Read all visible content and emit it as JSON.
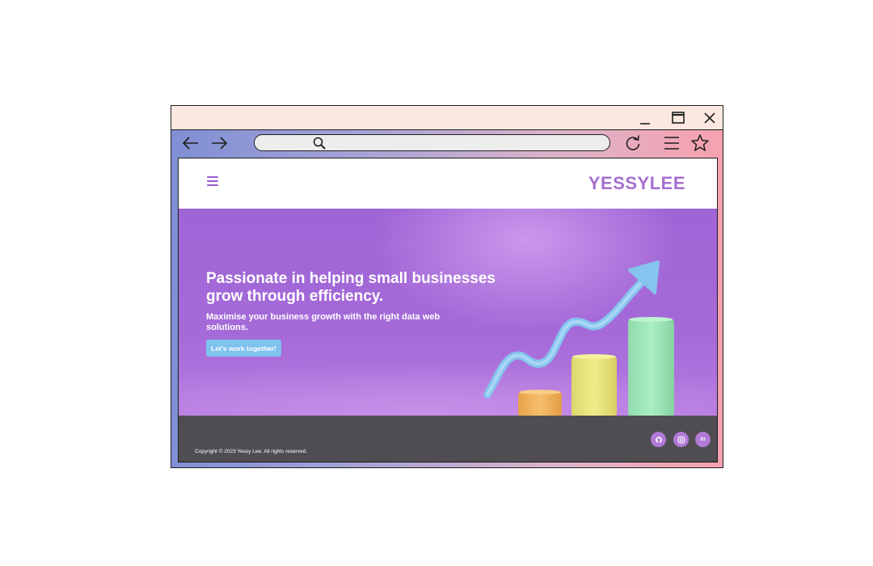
{
  "browser": {
    "window_controls": {
      "minimize_icon": "minimize-icon",
      "maximize_icon": "maximize-icon",
      "close_icon": "close-icon"
    },
    "toolbar": {
      "back_icon": "arrow-left-icon",
      "forward_icon": "arrow-right-icon",
      "reload_icon": "reload-icon",
      "menu_icon": "hamburger-icon",
      "bookmark_icon": "star-icon"
    },
    "address_bar": {
      "value": "",
      "placeholder": "",
      "icon": "search-icon"
    },
    "gradient_colors": [
      "#7f8fd4",
      "#f7a1ae"
    ],
    "titlebar_color": "#fde8e1"
  },
  "site": {
    "header": {
      "menu_icon": "hamburger-icon",
      "brand": "YESSYLEE",
      "brand_color": "#a46fd0"
    },
    "hero": {
      "headline": "Passionate in helping small businesses grow through efficiency.",
      "subheadline": "Maximise your business growth with the right data web solutions.",
      "cta_label": "Let's work together!",
      "cta_color": "#7ec2ee",
      "background_color": "#a066d6",
      "illustration": "growth-chart-illustration"
    },
    "footer": {
      "copyright": "Copyright © 2023 Yessy Lee. All rights reserved.",
      "background_color": "#4f4d52",
      "social_links": [
        {
          "name": "github-icon",
          "label": ""
        },
        {
          "name": "instagram-icon",
          "label": ""
        },
        {
          "name": "linkedin-icon",
          "label": "in"
        }
      ]
    }
  }
}
